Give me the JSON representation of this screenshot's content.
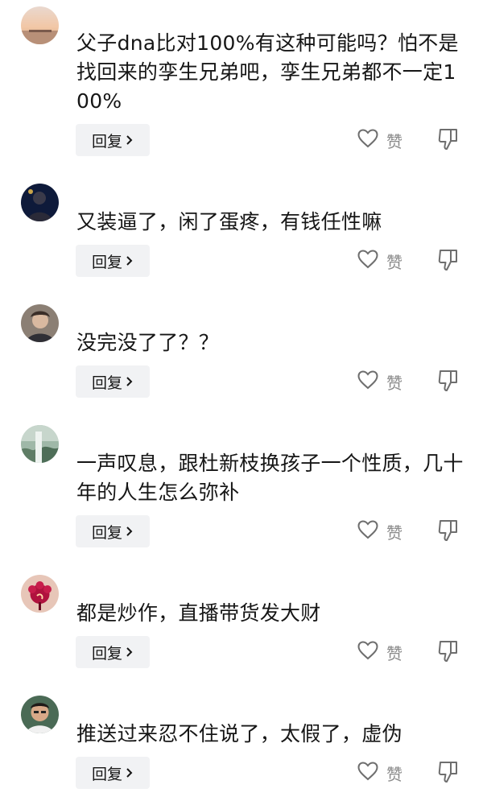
{
  "comments": [
    {
      "avatar": "sunset-beach-avatar",
      "text": "父子dna比对100%有这种可能吗？怕不是找回来的孪生兄弟吧，孪生兄弟都不一定100%",
      "reply_label": "回复",
      "like_label": "赞"
    },
    {
      "avatar": "dark-portrait-avatar",
      "text": "又装逼了，闲了蛋疼，有钱任性嘛",
      "reply_label": "回复",
      "like_label": "赞"
    },
    {
      "avatar": "person-photo-avatar",
      "text": "没完没了了？？",
      "reply_label": "回复",
      "like_label": "赞"
    },
    {
      "avatar": "waterfall-avatar",
      "text": "一声叹息，跟杜新枝换孩子一个性质，几十年的人生怎么弥补",
      "reply_label": "回复",
      "like_label": "赞"
    },
    {
      "avatar": "red-flower-avatar",
      "text": "都是炒作，直播带货发大财",
      "reply_label": "回复",
      "like_label": "赞"
    },
    {
      "avatar": "man-portrait-avatar",
      "text": "推送过来忍不住说了，太假了，虚伪",
      "reply_label": "回复",
      "like_label": "赞"
    }
  ],
  "colors": {
    "text": "#161616",
    "muted": "#8a8a8a",
    "button_bg": "#f1f2f4",
    "icon": "#6e6e6e"
  }
}
